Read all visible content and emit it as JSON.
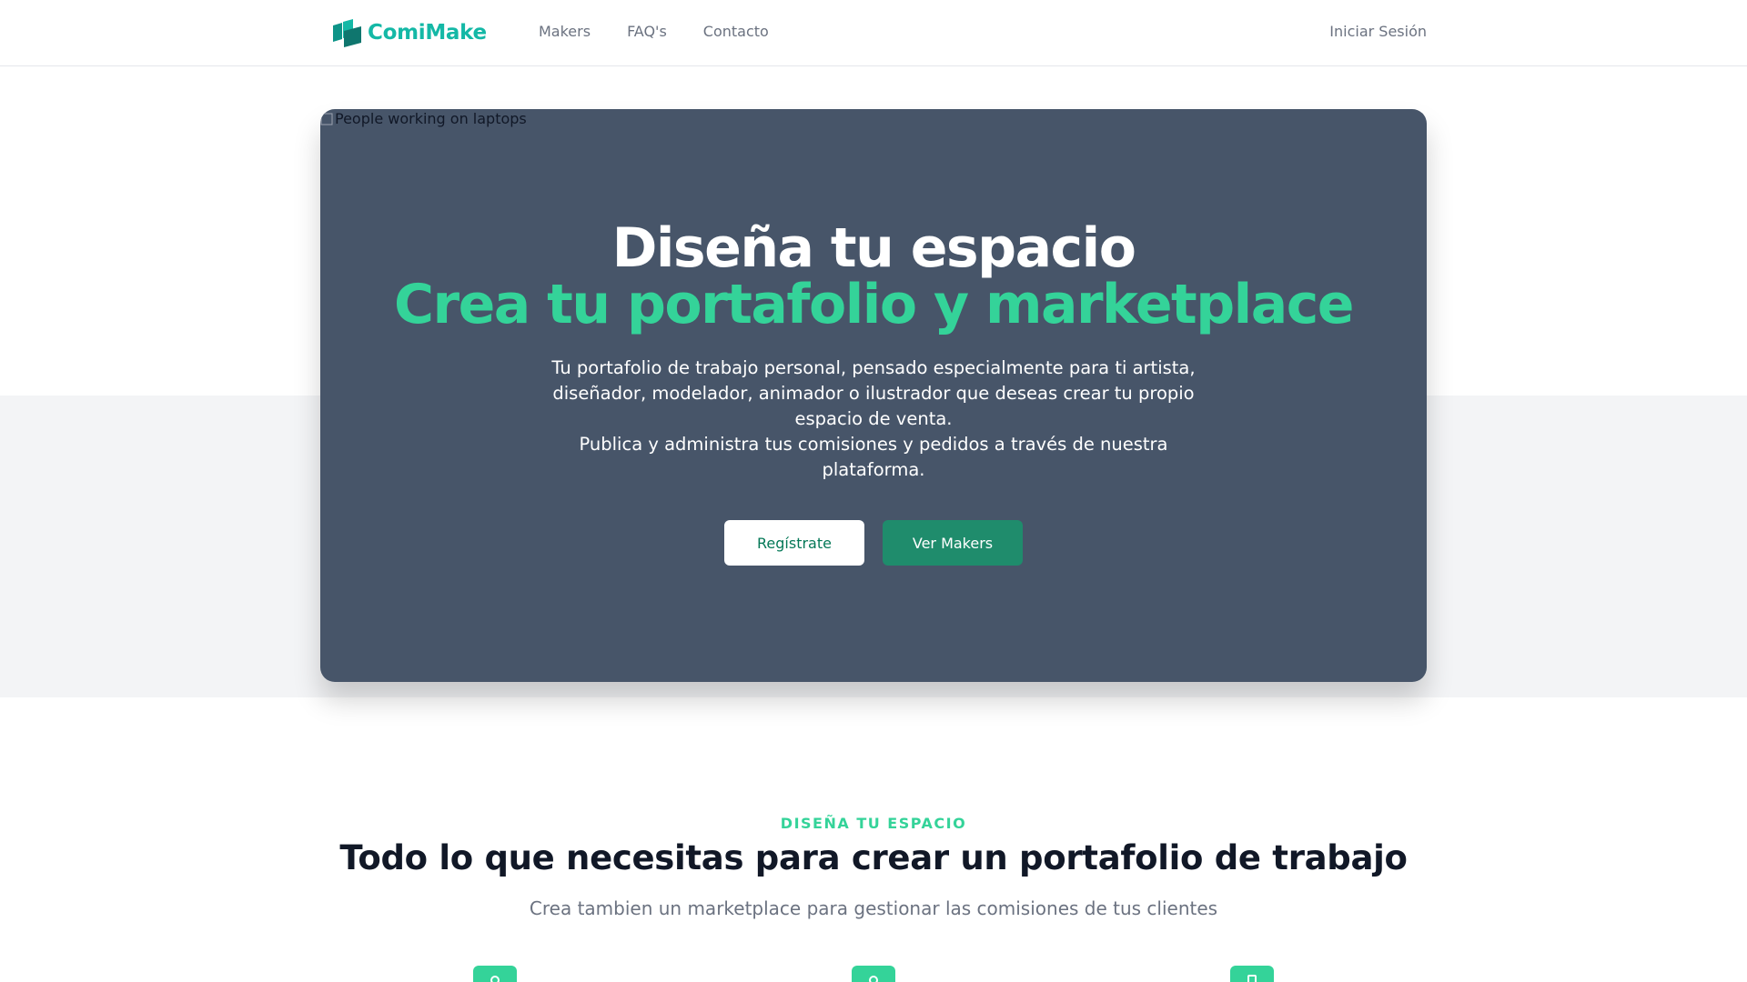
{
  "header": {
    "logo_text": "ComiMake",
    "nav": [
      {
        "label": "Makers"
      },
      {
        "label": "FAQ's"
      },
      {
        "label": "Contacto"
      }
    ],
    "signin_label": "Iniciar Sesión"
  },
  "hero": {
    "image_alt": "People working on laptops",
    "title_line1": "Diseña tu espacio",
    "title_line2": "Crea tu portafolio y marketplace",
    "description_p1": "Tu portafolio de trabajo personal, pensado especialmente para ti artista, diseñador, modelador, animador o ilustrador que deseas crear tu propio espacio de venta.",
    "description_p2": "Publica y administra tus comisiones y pedidos a través de nuestra plataforma.",
    "primary_button": "Regístrate",
    "secondary_button": "Ver Makers"
  },
  "features": {
    "eyebrow": "DISEÑA TU ESPACIO",
    "title": "Todo lo que necesitas para crear un portafolio de trabajo",
    "subtitle": "Crea tambien un marketplace para gestionar las comisiones de tus clientes",
    "icons": [
      "user-icon",
      "user-icon",
      "document-icon"
    ]
  },
  "colors": {
    "brand": "#14b8a6",
    "accent_green": "#34d399",
    "hero_bg": "#475569",
    "button_green": "#1f8c6c"
  }
}
